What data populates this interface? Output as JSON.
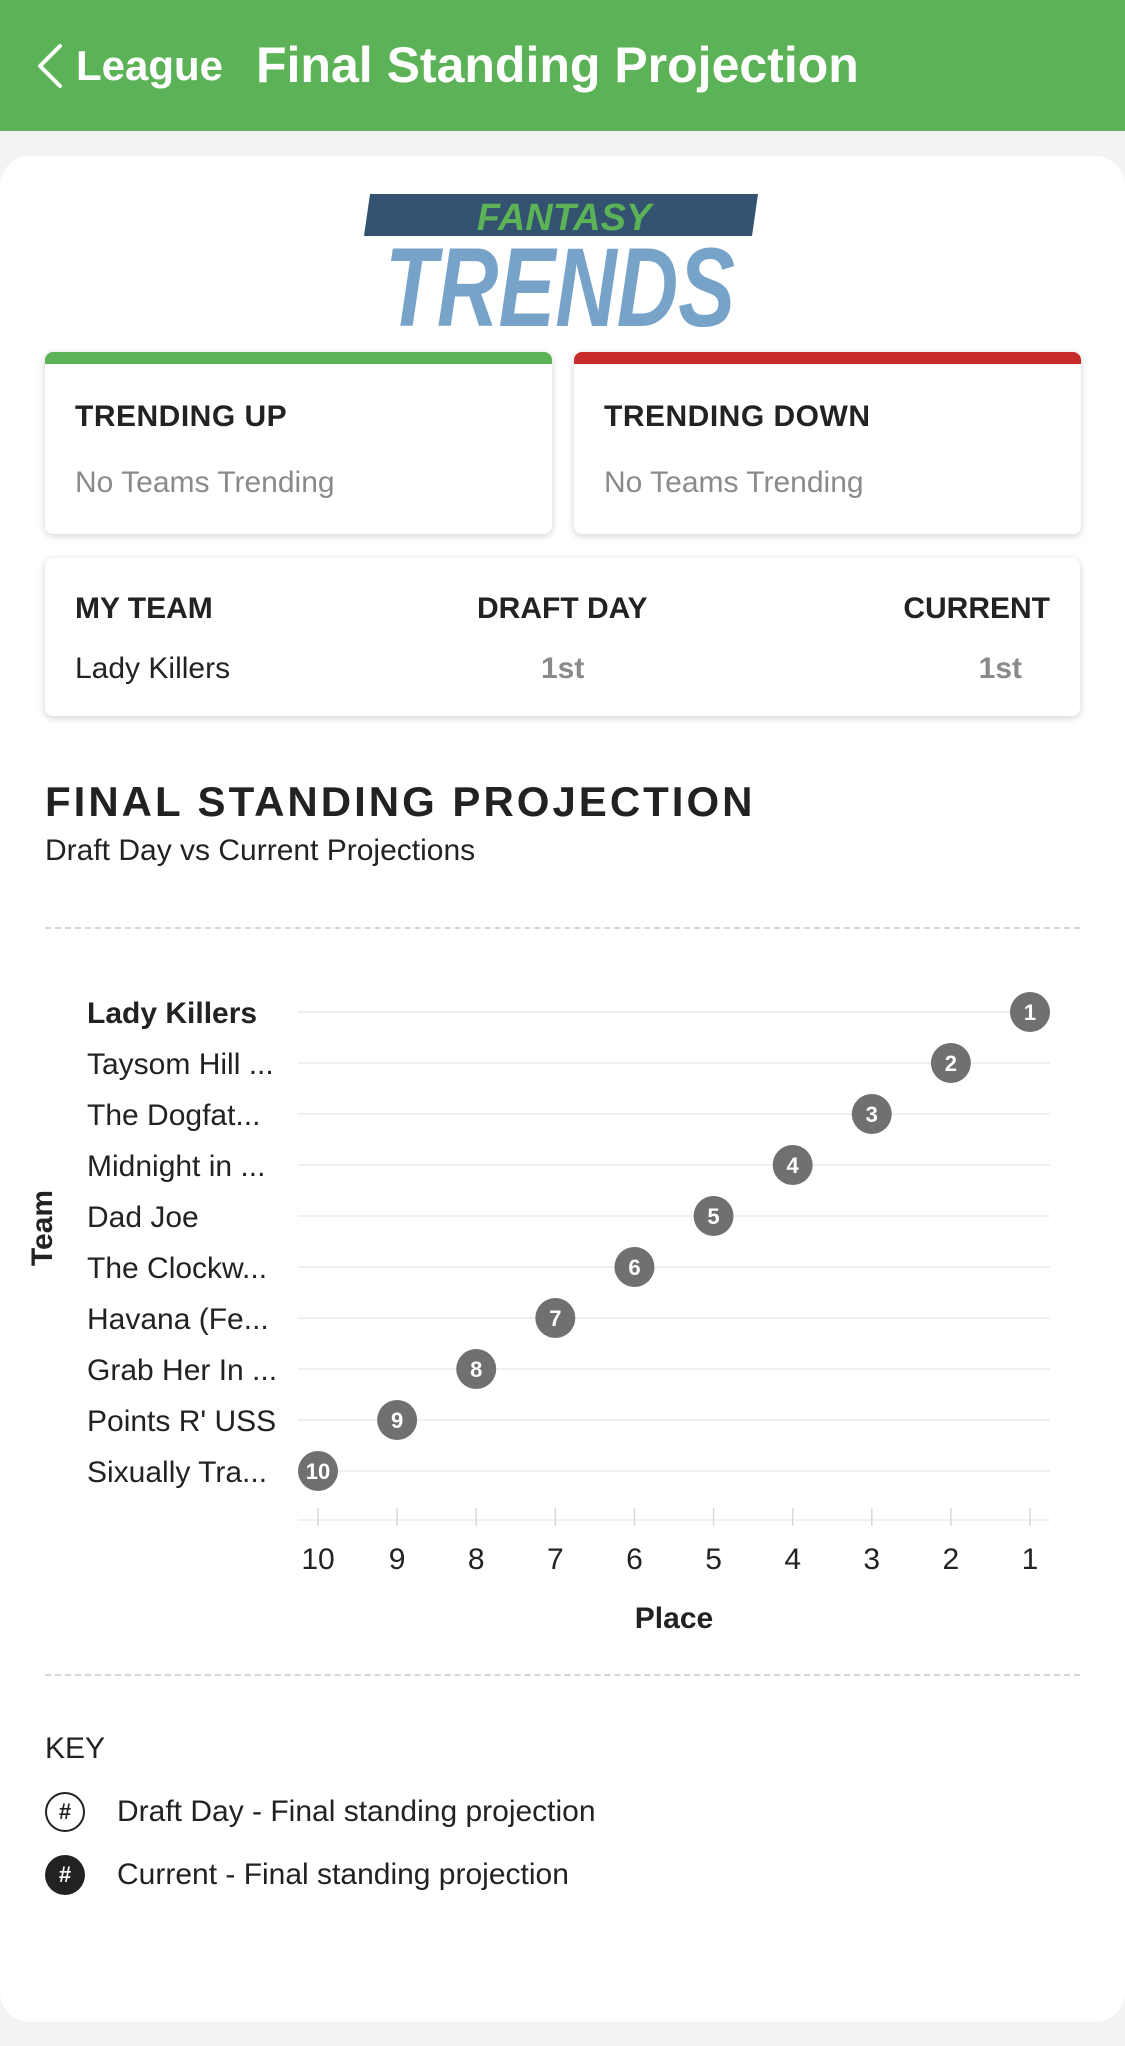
{
  "header": {
    "back_label": "League",
    "title": "Final Standing Projection"
  },
  "logo": {
    "line1": "FANTASY",
    "line2": "TRENDS",
    "colors": {
      "band": "#33526f",
      "fantasy": "#5cb256",
      "trends": "#78a3c9"
    }
  },
  "trending_up": {
    "title": "TRENDING UP",
    "text": "No Teams Trending",
    "accent": "#5cb256"
  },
  "trending_down": {
    "title": "TRENDING DOWN",
    "text": "No Teams Trending",
    "accent": "#c62a2a"
  },
  "my_team": {
    "headers": [
      "MY TEAM",
      "DRAFT DAY",
      "CURRENT"
    ],
    "team_name": "Lady Killers",
    "draft_day": "1st",
    "current": "1st"
  },
  "section": {
    "title": "FINAL STANDING PROJECTION",
    "subtitle": "Draft Day vs Current Projections"
  },
  "chart_data": {
    "type": "scatter",
    "ylabel": "Team",
    "xlabel": "Place",
    "x_ticks": [
      "10",
      "9",
      "8",
      "7",
      "6",
      "5",
      "4",
      "3",
      "2",
      "1"
    ],
    "xlim": [
      10,
      1
    ],
    "teams": [
      "Lady Killers",
      "Taysom Hill ...",
      "The Dogfat...",
      "Midnight in ...",
      "Dad Joe",
      "The Clockw...",
      "Havana (Fe...",
      "Grab Her In ...",
      "Points R' USS",
      "Sixually Tra..."
    ],
    "current_place": [
      1,
      2,
      3,
      4,
      5,
      6,
      7,
      8,
      9,
      10
    ],
    "highlight_team": "Lady Killers",
    "marker_color": "#707070"
  },
  "key": {
    "title": "KEY",
    "symbol": "#",
    "draft_label": "Draft Day - Final standing projection",
    "current_label": "Current - Final standing projection"
  }
}
